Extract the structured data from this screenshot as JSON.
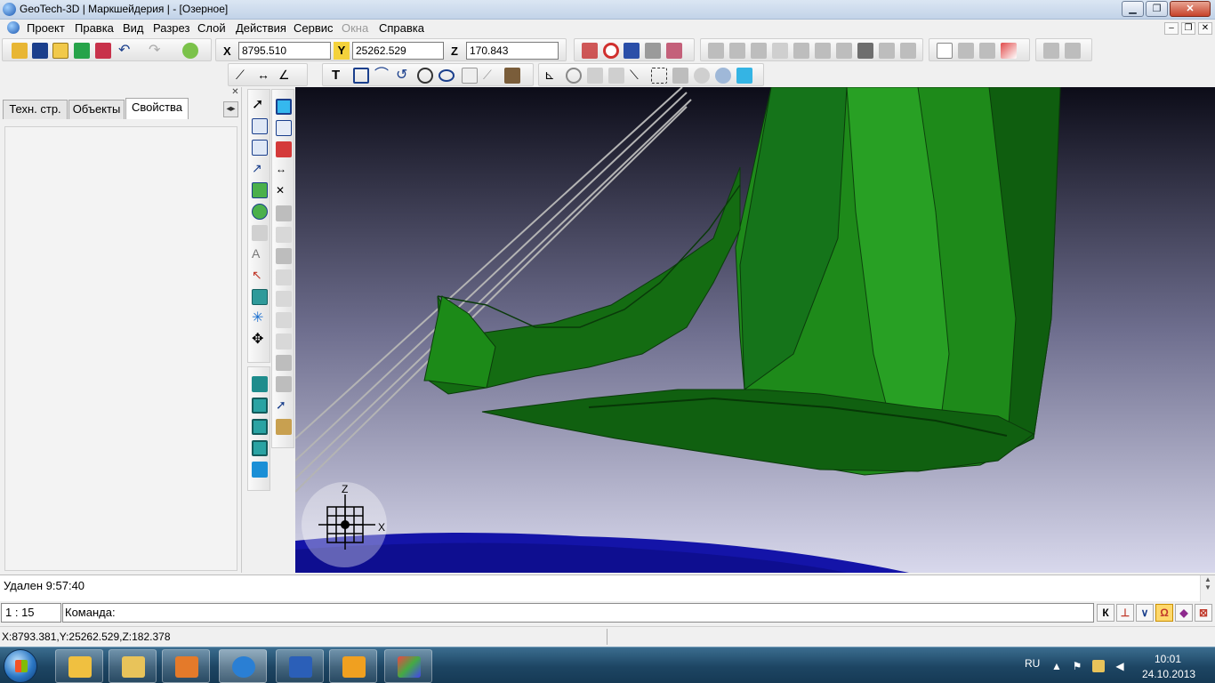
{
  "window": {
    "title": "GeoTech-3D | Маркшейдерия | - [Озерное]",
    "minimize_label": "▁",
    "restore_label": "❐",
    "close_label": "✕"
  },
  "menu": {
    "items": [
      "Проект",
      "Правка",
      "Вид",
      "Разрез",
      "Слой",
      "Действия",
      "Сервис",
      "Окна",
      "Справка"
    ],
    "mdi_min": "–",
    "mdi_restore": "❐",
    "mdi_close": "✕"
  },
  "coords": {
    "x_label": "X",
    "x_value": "8795.510",
    "y_label": "Y",
    "y_value": "25262.529",
    "z_label": "Z",
    "z_value": "170.843"
  },
  "left_panel": {
    "close_label": "✕",
    "tabs": [
      "Техн. стр.",
      "Объекты",
      "Свойства"
    ],
    "active_tab": "Свойства",
    "nav_label": "◂▸"
  },
  "viewport": {
    "axis_z": "Z",
    "axis_x": "X",
    "colors": {
      "background_top": "#0c0c18",
      "background_bottom": "#d8d8ec",
      "surface_green": "#1e8a1a",
      "surface_dark": "#0c4e0c",
      "ground_blue": "#1414a8"
    }
  },
  "log": {
    "message": "Удален 9:57:40"
  },
  "command": {
    "scale": "1 : 15",
    "prompt": "Команда:",
    "snap_buttons": [
      "К",
      "⊥",
      "∨",
      "Ω",
      "◆",
      "⊠"
    ]
  },
  "status": {
    "cursor_coords": "X:8793.381,Y:25262.529,Z:182.378"
  },
  "taskbar": {
    "language": "RU",
    "time": "10:01",
    "date": "24.10.2013"
  }
}
